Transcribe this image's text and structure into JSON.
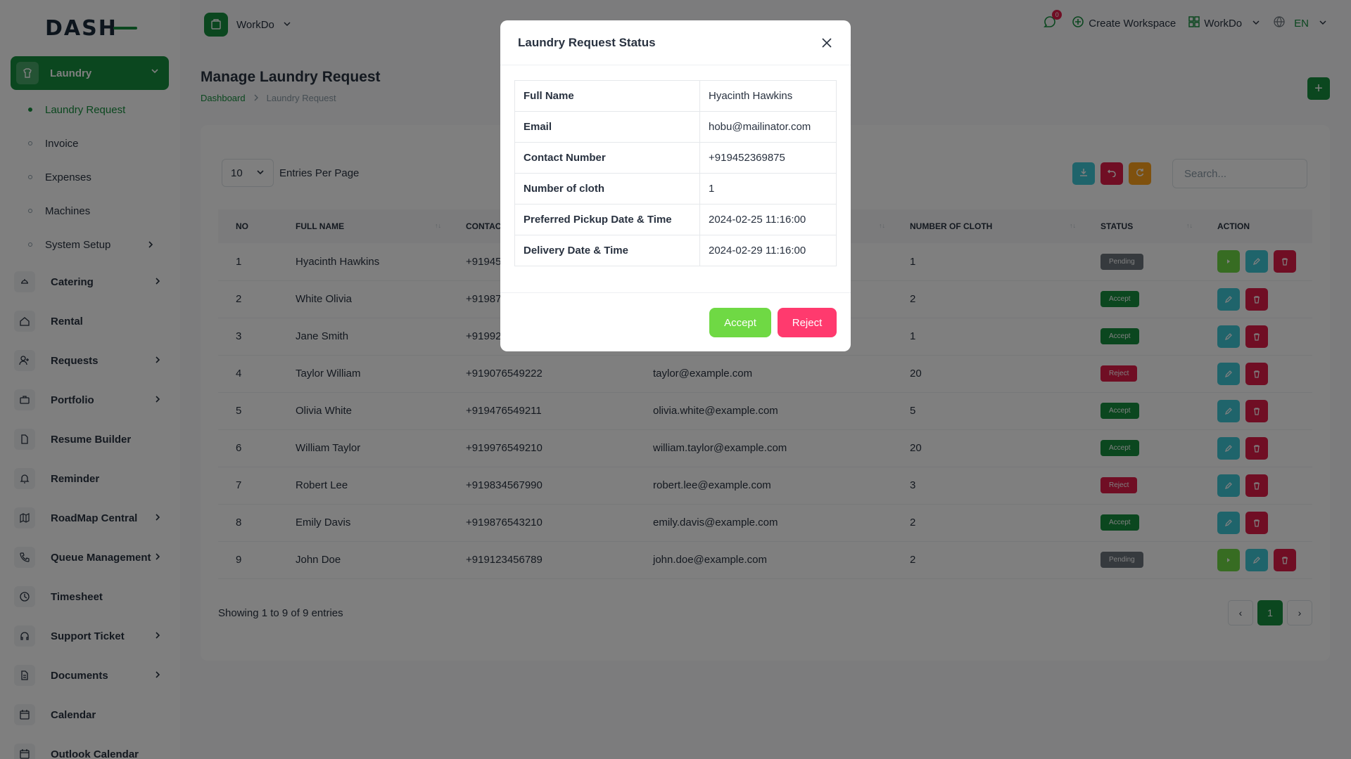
{
  "sidebar": {
    "logo": "DASH",
    "active_section": "Laundry",
    "sub_items": [
      {
        "label": "Laundry Request",
        "active": true
      },
      {
        "label": "Invoice"
      },
      {
        "label": "Expenses"
      },
      {
        "label": "Machines"
      },
      {
        "label": "System Setup"
      }
    ],
    "items": [
      {
        "label": "Catering",
        "icon": "cutlery-icon"
      },
      {
        "label": "Rental",
        "icon": "home-icon"
      },
      {
        "label": "Requests",
        "icon": "user-plus-icon"
      },
      {
        "label": "Portfolio",
        "icon": "briefcase-icon"
      },
      {
        "label": "Resume Builder",
        "icon": "file-icon"
      },
      {
        "label": "Reminder",
        "icon": "bell-icon"
      },
      {
        "label": "RoadMap Central",
        "icon": "map-icon"
      },
      {
        "label": "Queue Management",
        "icon": "phone-icon"
      },
      {
        "label": "Timesheet",
        "icon": "clock-icon"
      },
      {
        "label": "Support Ticket",
        "icon": "headset-icon"
      },
      {
        "label": "Documents",
        "icon": "document-icon"
      },
      {
        "label": "Calendar",
        "icon": "calendar-icon"
      },
      {
        "label": "Outlook Calendar",
        "icon": "calendar-icon"
      }
    ]
  },
  "header": {
    "workspace": "WorkDo",
    "notifications_count": "0",
    "create_workspace": "Create Workspace",
    "workspace_menu": "WorkDo",
    "language": "EN"
  },
  "page": {
    "title": "Manage Laundry Request",
    "breadcrumb": [
      "Dashboard",
      "Laundry Request"
    ]
  },
  "table": {
    "per_page": "10",
    "per_page_label": "Entries Per Page",
    "search_placeholder": "Search...",
    "columns": [
      "NO",
      "FULL NAME",
      "CONTAC",
      "",
      "NUMBER OF CLOTH",
      "STATUS",
      "ACTION"
    ],
    "rows": [
      {
        "no": "1",
        "name": "Hyacinth Hawkins",
        "contact": "+91945",
        "email": "",
        "cloth": "1",
        "status": "Pending"
      },
      {
        "no": "2",
        "name": "White Olivia",
        "contact": "+91987",
        "email": "",
        "cloth": "2",
        "status": "Accept"
      },
      {
        "no": "3",
        "name": "Jane Smith",
        "contact": "+91992",
        "email": "",
        "cloth": "1",
        "status": "Accept"
      },
      {
        "no": "4",
        "name": "Taylor William",
        "contact": "+919076549222",
        "email": "taylor@example.com",
        "cloth": "20",
        "status": "Reject"
      },
      {
        "no": "5",
        "name": "Olivia White",
        "contact": "+919476549211",
        "email": "olivia.white@example.com",
        "cloth": "5",
        "status": "Accept"
      },
      {
        "no": "6",
        "name": "William Taylor",
        "contact": "+919976549210",
        "email": "william.taylor@example.com",
        "cloth": "20",
        "status": "Accept"
      },
      {
        "no": "7",
        "name": "Robert Lee",
        "contact": "+919834567990",
        "email": "robert.lee@example.com",
        "cloth": "3",
        "status": "Reject"
      },
      {
        "no": "8",
        "name": "Emily Davis",
        "contact": "+919876543210",
        "email": "emily.davis@example.com",
        "cloth": "2",
        "status": "Accept"
      },
      {
        "no": "9",
        "name": "John Doe",
        "contact": "+919123456789",
        "email": "john.doe@example.com",
        "cloth": "2",
        "status": "Pending"
      }
    ],
    "showing": "Showing 1 to 9 of 9 entries",
    "current_page": "1"
  },
  "modal": {
    "title": "Laundry Request Status",
    "details": [
      {
        "label": "Full Name",
        "value": "Hyacinth Hawkins"
      },
      {
        "label": "Email",
        "value": "hobu@mailinator.com"
      },
      {
        "label": "Contact Number",
        "value": "+919452369875"
      },
      {
        "label": "Number of cloth",
        "value": "1"
      },
      {
        "label": "Preferred Pickup Date & Time",
        "value": "2024-02-25 11:16:00"
      },
      {
        "label": "Delivery Date & Time",
        "value": "2024-02-29 11:16:00"
      }
    ],
    "accept_label": "Accept",
    "reject_label": "Reject"
  },
  "colors": {
    "primary": "#168e3e",
    "accept_button": "#6fd944",
    "reject_button": "#ff3a6e",
    "action_cyan": "#3ec9d6",
    "danger": "#e11d48",
    "warning": "#ffa21d"
  }
}
